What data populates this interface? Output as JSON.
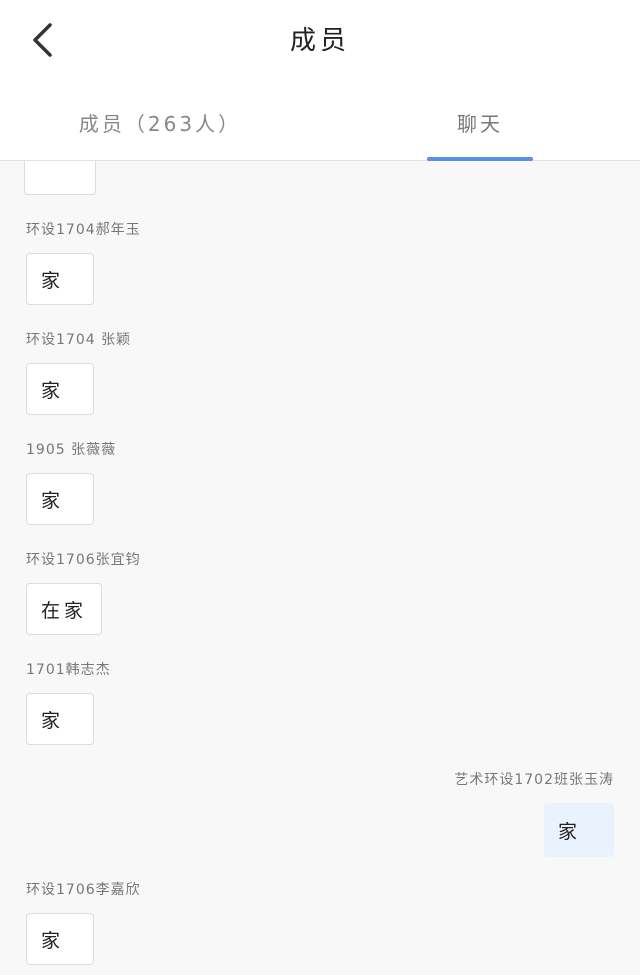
{
  "header": {
    "title": "成员"
  },
  "tabs": [
    {
      "label": "成员（263人）",
      "active": false
    },
    {
      "label": "聊天",
      "active": true
    }
  ],
  "colors": {
    "accent": "#5b8ee6",
    "self_bubble": "#eaf2fd"
  },
  "messages": [
    {
      "sender": "环设1704郝年玉",
      "text": "家"
    },
    {
      "sender": "环设1704 张颖",
      "text": "家"
    },
    {
      "sender": "1905 张薇薇",
      "text": "家"
    },
    {
      "sender": "环设1706张宜钧",
      "text": "在家"
    },
    {
      "sender": "1701韩志杰",
      "text": "家"
    },
    {
      "sender": "艺术环设1702班张玉涛",
      "text": "家",
      "self": true
    },
    {
      "sender": "环设1706李嘉欣",
      "text": "家"
    }
  ]
}
